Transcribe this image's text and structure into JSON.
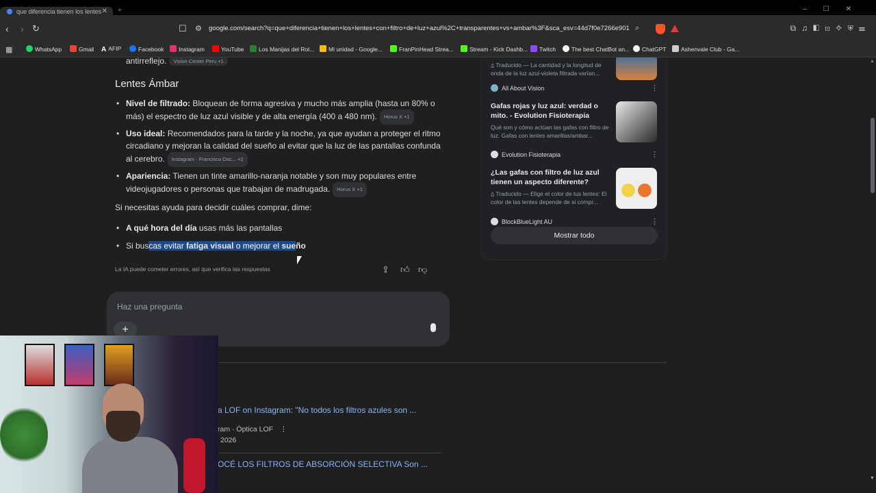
{
  "browser": {
    "tab_title": "que diferencia tienen los lentes",
    "url": "google.com/search?q=que+diferencia+tienen+los+lentes+con+filtro+de+luz+azul%2C+transparentes+vs+ambar%3F&sca_esv=44d7f0e7266e901...",
    "bookmarks": [
      "WhatsApp",
      "Gmail",
      "AFIP",
      "Facebook",
      "Instagram",
      "YouTube",
      "Los Manijas del Rol...",
      "Mi unidad - Google...",
      "FranPinHead Strea...",
      "Stream - Kick Dashb...",
      "Twitch",
      "The best ChatBot an...",
      "ChatGPT",
      "Ashenvale Club - Ga..."
    ],
    "bookmark_colors": [
      "#25d366",
      "#ea4335",
      "#ffffff",
      "#1877f2",
      "#e1306c",
      "#ff0000",
      "#2e7d32",
      "#fbbc04",
      "#53fc18",
      "#53fc18",
      "#9146ff",
      "#ffffff",
      "#ffffff",
      "#cccccc"
    ]
  },
  "answer": {
    "prev_text": "antirreflejo.",
    "prev_chip": "Vision Center Peru +1",
    "section_title": "Lentes Ámbar",
    "b1_label": "Nivel de filtrado:",
    "b1_text": " Bloquean de forma agresiva y mucho más amplia (hasta un 80% o más) el espectro de luz azul visible y de alta energía (400 a 480 nm).",
    "b1_chip": "Horus X +1",
    "b2_label": "Uso ideal:",
    "b2_text": " Recomendados para la tarde y la noche, ya que ayudan a proteger el ritmo circadiano y mejoran la calidad del sueño al evitar que la luz de las pantallas confunda al cerebro.",
    "b2_chip": "Instagram · Francisco Osc... +2",
    "b3_label": "Apariencia:",
    "b3_text": " Tienen un tinte amarillo-naranja notable y son muy populares entre videojugadores o personas que trabajan de madrugada.",
    "b3_chip": "Horus X +1",
    "help_text": "Si necesitas ayuda para decidir cuáles comprar, dime:",
    "q1_label": "A qué hora del día",
    "q1_text": " usas más las pantallas",
    "q2_a": "Si bus",
    "q2_b": "cas evitar ",
    "q2_c": "fatiga visual",
    "q2_d": " o mejorar el ",
    "q2_e": "sue",
    "q2_f": "ño",
    "disclaimer": "La IA puede cometer errores, así que verifica las respuestas",
    "ask_placeholder": "Haz una pregunta"
  },
  "results": {
    "r1_title": "a LOF on Instagram: \"No todos los filtros azules son ...",
    "r1_meta": "ram · Óptica LOF",
    "r1_date": "2026",
    "r2_title": "OCÉ LOS FILTROS DE ABSORCIÓN SELECTIVA Son ..."
  },
  "side": {
    "c1_desc": "Traducido — La cantidad y la longitud de onda de la luz azul-violeta filtrada varían...",
    "c1_src": "All About Vision",
    "c2_title": "Gafas rojas y luz azul: verdad o mito. - Evolution Fisioterapia",
    "c2_desc": "Qué son y cómo actúan las gafas con filtro de luz. Gafas con lentes amarillas/ambar...",
    "c2_src": "Evolution Fisioterapia",
    "c3_title": "¿Las gafas con filtro de luz azul tienen un aspecto diferente?",
    "c3_desc": "Traducido — Elige el color de tus lentes: El color de las lentes depende de si compr...",
    "c3_src": "BlockBlueLight AU",
    "show_all": "Mostrar todo"
  }
}
